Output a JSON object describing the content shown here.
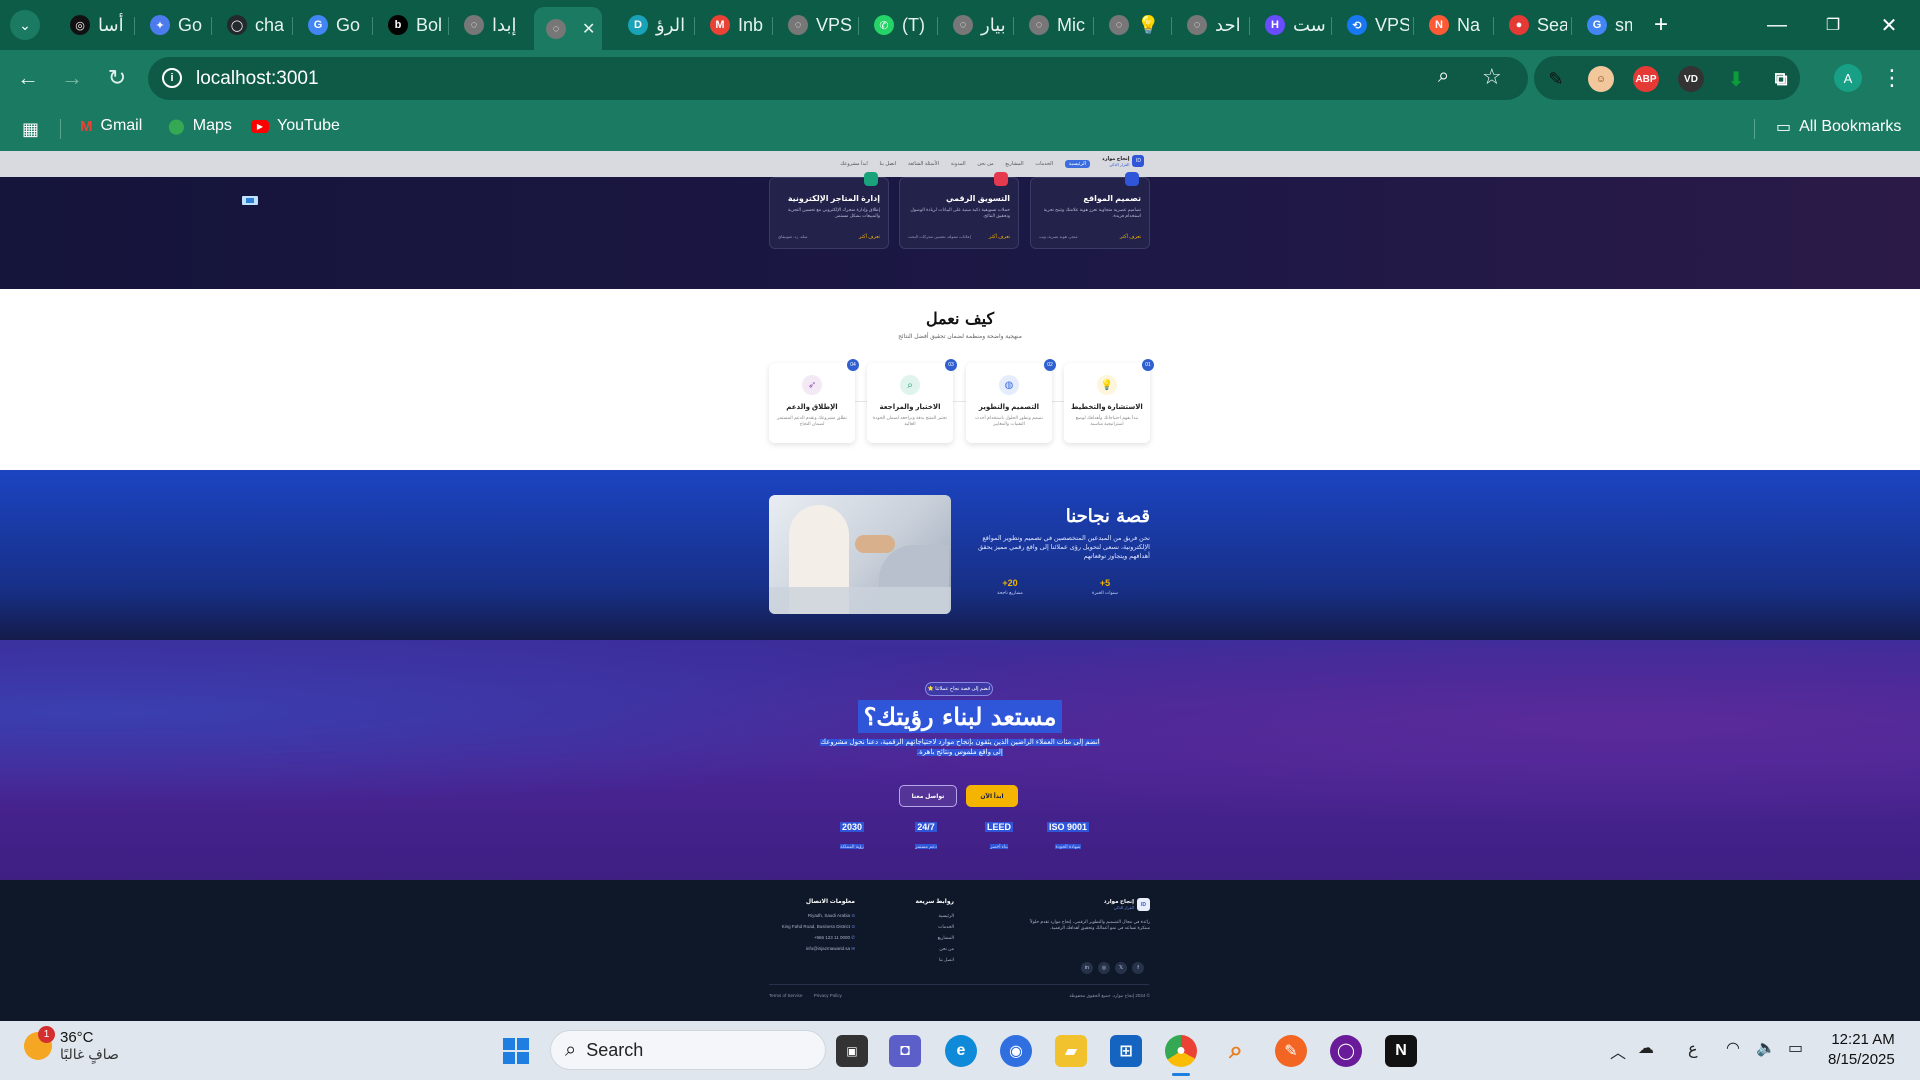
{
  "browser": {
    "tabs": [
      {
        "label": "أسا",
        "color": "#111111",
        "glyph": "◎"
      },
      {
        "label": "Go",
        "color": "#4b7bec",
        "glyph": "✦"
      },
      {
        "label": "cha",
        "color": "#24292e",
        "glyph": "◯"
      },
      {
        "label": "Go",
        "color": "#4285f4",
        "glyph": "G"
      },
      {
        "label": "Bol",
        "color": "#000000",
        "glyph": "b"
      },
      {
        "label": "إبدا",
        "color": "#777777",
        "glyph": "◌"
      },
      {
        "label": "",
        "color": "#777777",
        "glyph": "◌"
      },
      {
        "label": "الرؤ",
        "color": "#1aa3b8",
        "glyph": "D"
      },
      {
        "label": "Inb",
        "color": "#ea4335",
        "glyph": "M"
      },
      {
        "label": "VPS",
        "color": "#777777",
        "glyph": "◌"
      },
      {
        "label": "(T)",
        "color": "#25d366",
        "glyph": "✆"
      },
      {
        "label": "بيار",
        "color": "#777777",
        "glyph": "◌"
      },
      {
        "label": "Mic",
        "color": "#777777",
        "glyph": "◌"
      },
      {
        "label": "💡",
        "color": "#777777",
        "glyph": "◌"
      },
      {
        "label": "احد",
        "color": "#777777",
        "glyph": "◌"
      },
      {
        "label": "است",
        "color": "#6a4cff",
        "glyph": "H"
      },
      {
        "label": "VPS",
        "color": "#1877f2",
        "glyph": "⟲"
      },
      {
        "label": "Na",
        "color": "#ff5a36",
        "glyph": "N"
      },
      {
        "label": "Sea",
        "color": "#e53935",
        "glyph": "●"
      },
      {
        "label": "sm",
        "color": "#4285f4",
        "glyph": "G"
      }
    ],
    "url": "localhost:3001",
    "bookmarks": {
      "gmail": "Gmail",
      "maps": "Maps",
      "youtube": "YouTube",
      "all": "All Bookmarks"
    },
    "profile_initial": "A"
  },
  "site": {
    "nav": {
      "brand": "إنجاح موارد",
      "brand_sub": "القرار الذكي",
      "links": [
        "الرئيسية",
        "الخدمات",
        "المشاريع",
        "من نحن",
        "المدونة",
        "الأسئلة الشائعة",
        "اتصل بنا",
        "ابدأ مشروعك"
      ]
    },
    "services": [
      {
        "title": "تصميم المواقع",
        "desc": "تصاميم عصرية متجاوبة تعزز هوية علامتك وتتيح تجربة استخدام فريدة.",
        "more": "تعرف أكثر",
        "tag": "متجر، هوية بصرية، ويب"
      },
      {
        "title": "التسويق الرقمي",
        "desc": "حملات تسويقية ذكية مبنية على البيانات لزيادة الوصول وتحقيق النتائج.",
        "more": "تعرف أكثر",
        "tag": "إعلانات ممولة، تحسين محركات البحث"
      },
      {
        "title": "إدارة المتاجر الإلكترونية",
        "desc": "إطلاق وإدارة متجرك الإلكتروني مع تحسين التجربة والمبيعات بشكل مستمر.",
        "more": "تعرف أكثر",
        "tag": "سلة، زد، شوبيفاي"
      }
    ],
    "how": {
      "title": "كيف نعمل",
      "subtitle": "منهجية واضحة ومنظمة لضمان تحقيق أفضل النتائج",
      "steps": [
        {
          "num": "01",
          "title": "الاستشارة والتخطيط",
          "desc": "نبدأ بفهم احتياجاتك وأهدافك لوضع استراتيجية مناسبة",
          "color": "#f4b400",
          "glyph": "💡"
        },
        {
          "num": "02",
          "title": "التصميم والتطوير",
          "desc": "نصمم ونطور الحلول باستخدام أحدث التقنيات والمعايير",
          "color": "#3b6ddf",
          "glyph": "◍"
        },
        {
          "num": "03",
          "title": "الاختبار والمراجعة",
          "desc": "نختبر المنتج بدقة ونراجعه لضمان الجودة العالية",
          "color": "#1aa37a",
          "glyph": "⌕"
        },
        {
          "num": "04",
          "title": "الإطلاق والدعم",
          "desc": "نطلق مشروعك ونقدم الدعم المستمر لضمان النجاح",
          "color": "#9b59b6",
          "glyph": "➶"
        }
      ]
    },
    "story": {
      "title": "قصة نجاحنا",
      "text": "نحن فريق من المبدعين المتخصصين في تصميم وتطوير المواقع الإلكترونية، نسعى لتحويل رؤى عملائنا إلى واقع رقمي مميز يحقق أهدافهم ويتجاوز توقعاتهم",
      "stats": [
        {
          "value": "+5",
          "label": "سنوات الخبرة"
        },
        {
          "value": "+20",
          "label": "مشاريع ناجحة"
        }
      ]
    },
    "cta": {
      "badge": "⭐ انضم إلى قصة نجاح عملائنا",
      "title": "مستعد لبناء رؤيتك؟",
      "text": "انضم إلى مئات العملاء الراضين الذين يثقون بإنجاح موارد لاحتياجاتهم الرقمية، دعنا نحول مشروعك إلى واقع ملموس ونتائج باهرة.",
      "primary": "ابدأ الآن",
      "secondary": "تواصل معنا",
      "certs": [
        {
          "value": "ISO 9001",
          "label": "شهادة الجودة"
        },
        {
          "value": "LEED",
          "label": "بناء أخضر"
        },
        {
          "value": "24/7",
          "label": "دعم مستمر"
        },
        {
          "value": "2030",
          "label": "رؤية المملكة"
        }
      ]
    },
    "footer": {
      "brand": "إنجاح موارد",
      "brand_sub": "القرار الذكي",
      "about": "رائدة في مجال التصميم والتطوير الرقمي، إنجاح موارد تقدم حلولاً مبتكرة تساعد في نمو أعمالك وتحقيق أهدافك الرقمية.",
      "quick_title": "روابط سريعة",
      "quick_links": [
        "الرئيسية",
        "الخدمات",
        "المشاريع",
        "من نحن",
        "اتصل بنا"
      ],
      "contact_title": "معلومات الاتصال",
      "contact": [
        "Riyadh, Saudi Arabia",
        "King Fahd Road, Business District",
        "+966 123 11 0000",
        "info@injazmawarid.sa"
      ],
      "copyright": "© 2024 إنجاح موارد. جميع الحقوق محفوظة",
      "legal": [
        "Terms of Service",
        "Privacy Policy"
      ]
    }
  },
  "taskbar": {
    "weather_temp": "36°C",
    "weather_desc": "صافٍ غالبًا",
    "weather_badge": "1",
    "search_placeholder": "Search",
    "lang": "ع",
    "time": "12:21 AM",
    "date": "8/15/2025"
  }
}
